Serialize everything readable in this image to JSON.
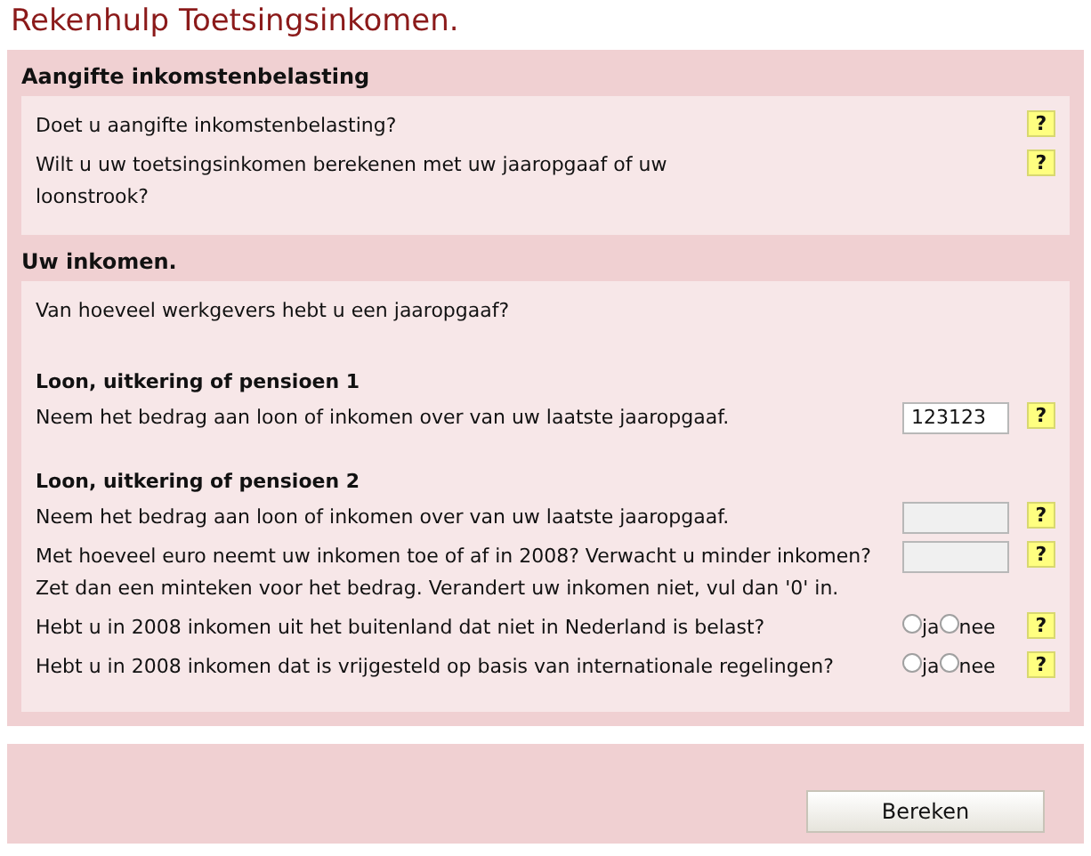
{
  "title": "Rekenhulp Toetsingsinkomen.",
  "sections": [
    {
      "title": "Aangifte inkomstenbelasting",
      "items": [
        {
          "kind": "question",
          "text": "Doet u aangifte inkomstenbelasting?",
          "help": "?"
        },
        {
          "kind": "question",
          "text": "Wilt u uw toetsingsinkomen berekenen met uw jaaropgaaf of uw loonstrook?",
          "help": "?"
        }
      ]
    },
    {
      "title": "Uw inkomen.",
      "items": [
        {
          "kind": "text",
          "text": "Van hoeveel werkgevers hebt u een jaaropgaaf?"
        },
        {
          "kind": "subheading",
          "text": "Loon, uitkering of pensioen 1"
        },
        {
          "kind": "input",
          "text": "Neem het bedrag aan loon of inkomen over van uw laatste jaaropgaaf.",
          "value": "123123",
          "help": "?"
        },
        {
          "kind": "subheading",
          "text": "Loon, uitkering of pensioen 2"
        },
        {
          "kind": "input",
          "text": "Neem het bedrag aan loon of inkomen over van uw laatste jaaropgaaf.",
          "help": "?"
        },
        {
          "kind": "input",
          "text": "Met hoeveel euro neemt uw inkomen toe of af in 2008? Verwacht u minder inkomen? Zet dan een minteken voor het bedrag. Verandert uw inkomen niet, vul dan '0' in.",
          "help": "?"
        },
        {
          "kind": "radio",
          "text": "Hebt u in 2008 inkomen uit het buitenland dat niet in Nederland is belast?",
          "options": [
            {
              "label": "ja",
              "selected": false
            },
            {
              "label": "nee",
              "selected": false
            }
          ],
          "help": "?"
        },
        {
          "kind": "radio",
          "text": "Hebt u in 2008 inkomen dat is vrijgesteld op basis van internationale regelingen?",
          "options": [
            {
              "label": "ja",
              "selected": false
            },
            {
              "label": "nee",
              "selected": false
            }
          ],
          "help": "?"
        }
      ]
    }
  ],
  "submit": "Bereken"
}
